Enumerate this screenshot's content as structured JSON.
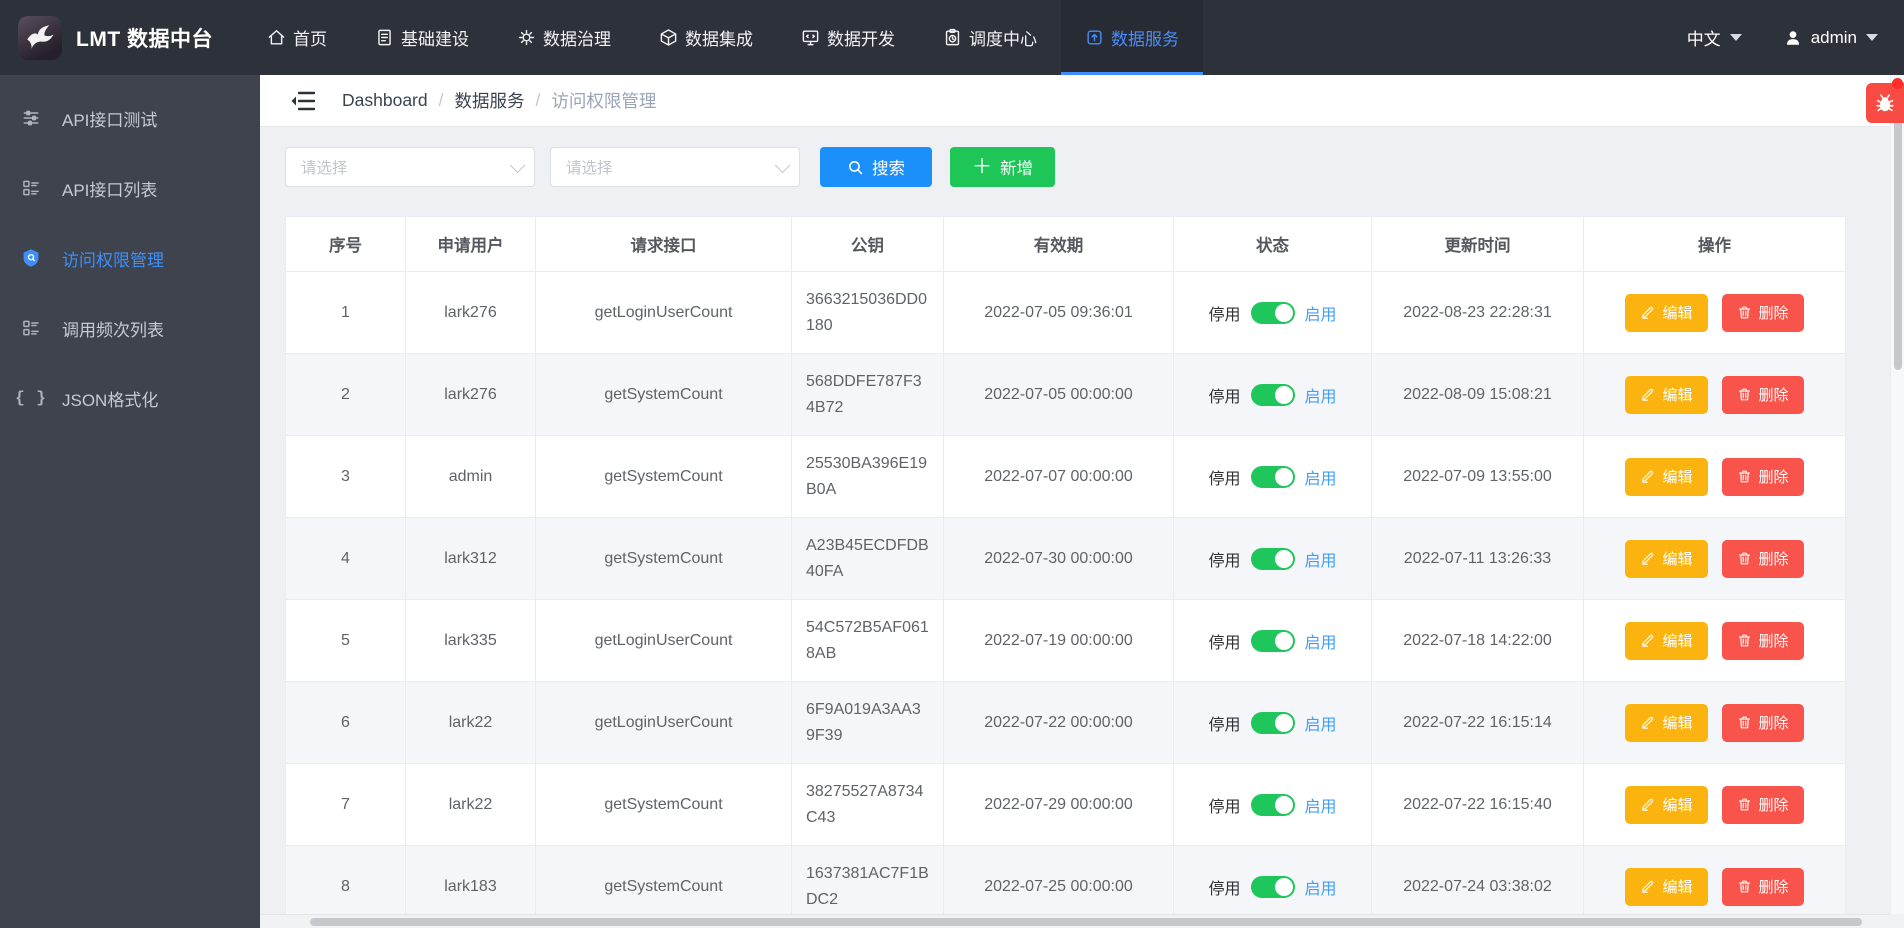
{
  "navbar": {
    "brand": "LMT 数据中台",
    "menu": [
      {
        "label": "首页"
      },
      {
        "label": "基础建设"
      },
      {
        "label": "数据治理"
      },
      {
        "label": "数据集成"
      },
      {
        "label": "数据开发"
      },
      {
        "label": "调度中心"
      },
      {
        "label": "数据服务"
      }
    ],
    "language": "中文",
    "user": "admin"
  },
  "sidebar": {
    "items": [
      {
        "label": "API接口测试"
      },
      {
        "label": "API接口列表"
      },
      {
        "label": "访问权限管理"
      },
      {
        "label": "调用频次列表"
      },
      {
        "label": "JSON格式化"
      }
    ]
  },
  "breadcrumb": {
    "items": [
      "Dashboard",
      "数据服务",
      "访问权限管理"
    ],
    "separator": "/"
  },
  "filters": {
    "select_placeholder_1": "请选择",
    "select_placeholder_2": "请选择",
    "search_label": "搜索",
    "add_label": "新增"
  },
  "table": {
    "headers": [
      "序号",
      "申请用户",
      "请求接口",
      "公钥",
      "有效期",
      "状态",
      "更新时间",
      "操作"
    ],
    "status_off": "停用",
    "status_on": "启用",
    "edit_label": "编辑",
    "delete_label": "删除",
    "rows": [
      {
        "index": "1",
        "user": "lark276",
        "api": "getLoginUserCount",
        "pubkey": "3663215036DD0180",
        "valid_until": "2022-07-05 09:36:01",
        "updated_at": "2022-08-23 22:28:31",
        "enabled": true
      },
      {
        "index": "2",
        "user": "lark276",
        "api": "getSystemCount",
        "pubkey": "568DDFE787F34B72",
        "valid_until": "2022-07-05 00:00:00",
        "updated_at": "2022-08-09 15:08:21",
        "enabled": true
      },
      {
        "index": "3",
        "user": "admin",
        "api": "getSystemCount",
        "pubkey": "25530BA396E19B0A",
        "valid_until": "2022-07-07 00:00:00",
        "updated_at": "2022-07-09 13:55:00",
        "enabled": true
      },
      {
        "index": "4",
        "user": "lark312",
        "api": "getSystemCount",
        "pubkey": "A23B45ECDFDB40FA",
        "valid_until": "2022-07-30 00:00:00",
        "updated_at": "2022-07-11 13:26:33",
        "enabled": true
      },
      {
        "index": "5",
        "user": "lark335",
        "api": "getLoginUserCount",
        "pubkey": "54C572B5AF0618AB",
        "valid_until": "2022-07-19 00:00:00",
        "updated_at": "2022-07-18 14:22:00",
        "enabled": true
      },
      {
        "index": "6",
        "user": "lark22",
        "api": "getLoginUserCount",
        "pubkey": "6F9A019A3AA39F39",
        "valid_until": "2022-07-22 00:00:00",
        "updated_at": "2022-07-22 16:15:14",
        "enabled": true
      },
      {
        "index": "7",
        "user": "lark22",
        "api": "getSystemCount",
        "pubkey": "38275527A8734C43",
        "valid_until": "2022-07-29 00:00:00",
        "updated_at": "2022-07-22 16:15:40",
        "enabled": true
      },
      {
        "index": "8",
        "user": "lark183",
        "api": "getSystemCount",
        "pubkey": "1637381AC7F1BDC2",
        "valid_until": "2022-07-25 00:00:00",
        "updated_at": "2022-07-24 03:38:02",
        "enabled": true
      }
    ]
  },
  "colors": {
    "primary_blue": "#1c90fa",
    "success_green": "#1dc657",
    "warning_amber": "#fbb310",
    "danger_red": "#f8544b",
    "nav_active_blue": "#4a8df8",
    "toggle_on_green": "#1ec65b"
  }
}
